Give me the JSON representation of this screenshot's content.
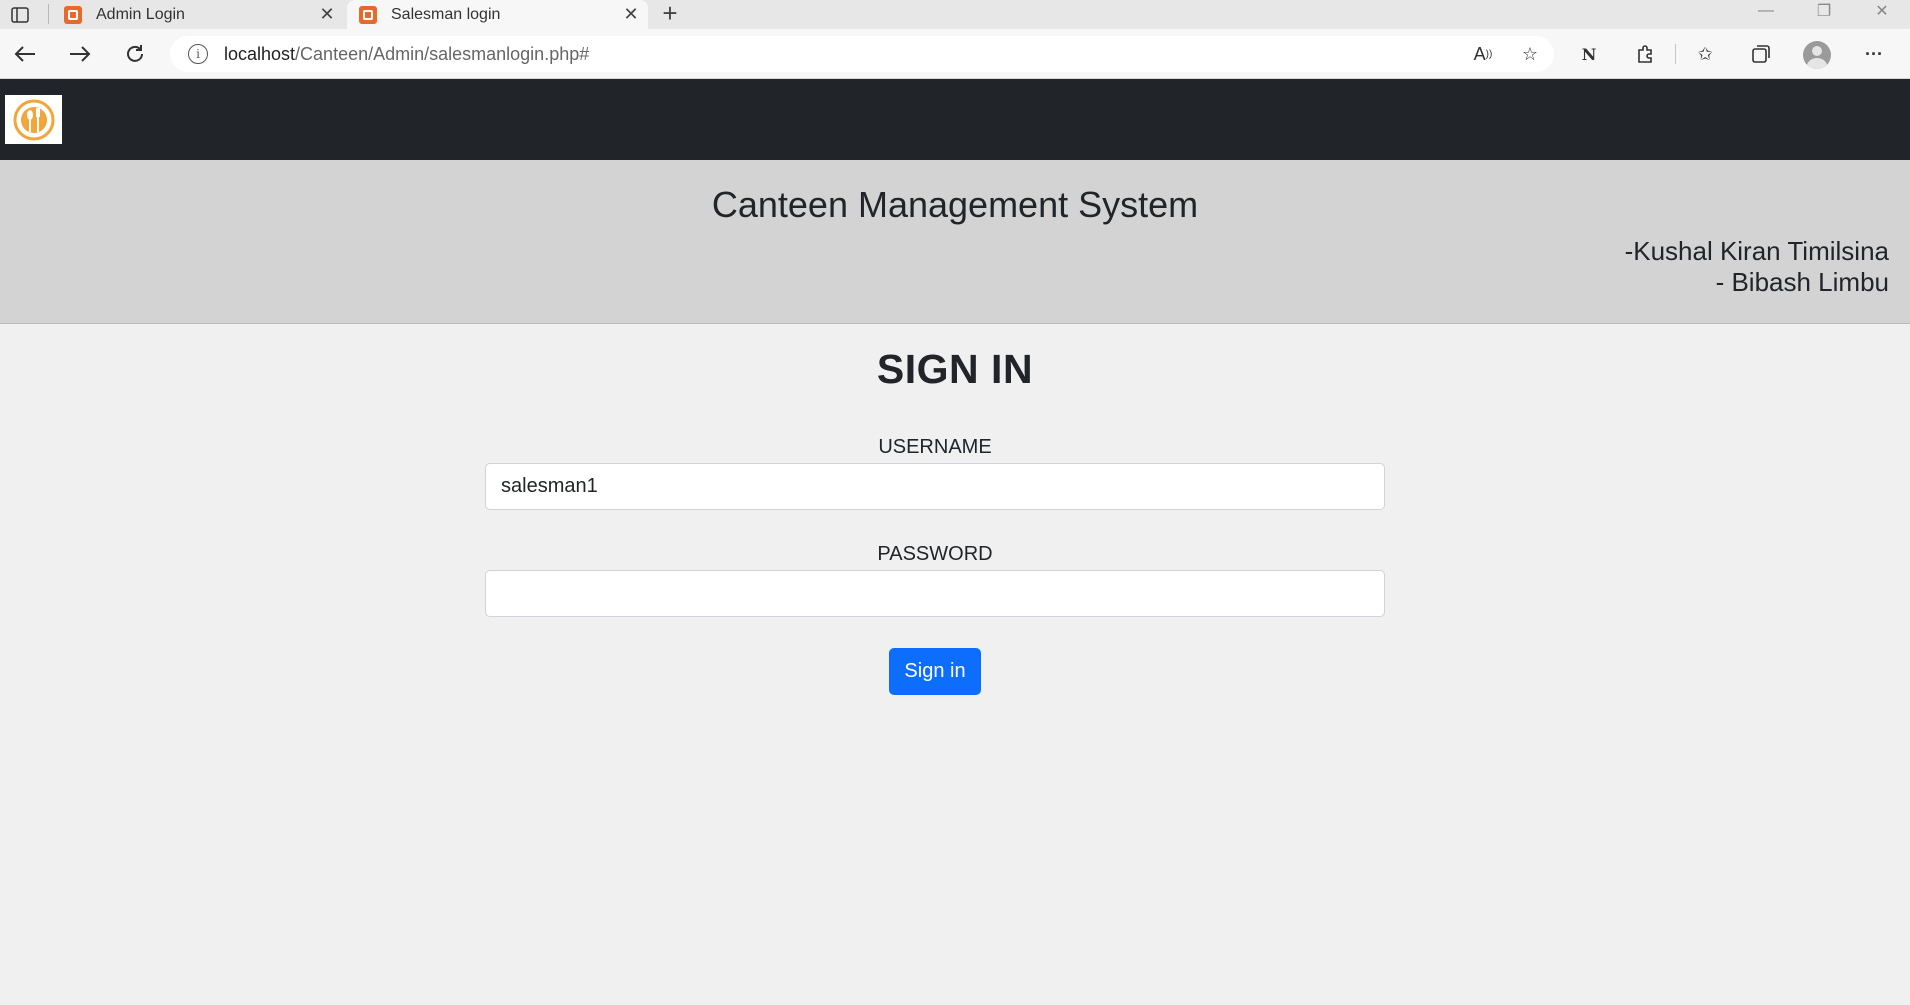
{
  "browser": {
    "tabs": [
      {
        "label": "Admin Login",
        "active": false
      },
      {
        "label": "Salesman login",
        "active": true
      }
    ],
    "url_host": "localhost",
    "url_path": "/Canteen/Admin/salesmanlogin.php#"
  },
  "header": {
    "title": "Canteen Management System",
    "authors": [
      "-Kushal Kiran Timilsina",
      "- Bibash Limbu"
    ]
  },
  "form": {
    "heading": "SIGN IN",
    "username_label": "USERNAME",
    "username_value": "salesman1",
    "password_label": "PASSWORD",
    "password_value": "",
    "submit_label": "Sign in"
  },
  "colors": {
    "navbar": "#212529",
    "hero": "#d3d3d3",
    "page_bg": "#f0f0f0",
    "primary_button": "#0d6efd",
    "logo_accent": "#f0a63a"
  }
}
